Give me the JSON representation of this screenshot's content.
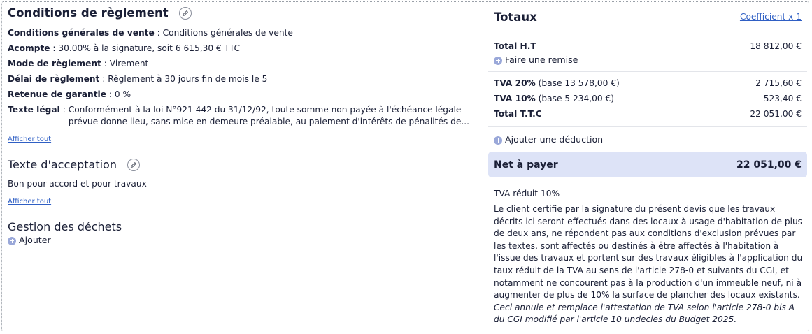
{
  "conditions": {
    "title": "Conditions de règlement",
    "rows": [
      {
        "label": "Conditions générales de vente",
        "value": "Conditions générales de vente"
      },
      {
        "label": "Acompte",
        "value": "30.00% à la signature, soit 6 615,30 € TTC"
      },
      {
        "label": "Mode de règlement",
        "value": "Virement"
      },
      {
        "label": "Délai de règlement",
        "value": "Règlement à 30 jours fin de mois le 5"
      },
      {
        "label": "Retenue de garantie",
        "value": "0 %"
      }
    ],
    "legal_label": "Texte légal",
    "legal_line1": "Conformément à la loi N°921 442 du 31/12/92, toute somme non payée à l'échéance légale",
    "legal_line2": "prévue donne lieu, sans mise en demeure préalable, au paiement d'intérêts de pénalités de...",
    "show_all": "Afficher tout"
  },
  "acceptance": {
    "title": "Texte d'acceptation",
    "text": "Bon pour accord et pour travaux",
    "show_all": "Afficher tout"
  },
  "waste": {
    "title": "Gestion des déchets",
    "add_label": "Ajouter"
  },
  "totals": {
    "title": "Totaux",
    "coefficient_link": "Coefficient x 1",
    "total_ht_label": "Total H.T",
    "total_ht_value": "18 812,00 €",
    "discount_label": "Faire une remise",
    "tva20_label": "TVA 20%",
    "tva20_base": "(base 13 578,00 €)",
    "tva20_value": "2 715,60 €",
    "tva10_label": "TVA 10%",
    "tva10_base": "(base 5 234,00 €)",
    "tva10_value": "523,40 €",
    "total_ttc_label": "Total T.T.C",
    "total_ttc_value": "22 051,00 €",
    "deduction_label": "Ajouter une déduction",
    "net_label": "Net à payer",
    "net_value": "22 051,00 €"
  },
  "tva_notice": {
    "title": "TVA réduit 10%",
    "body": "Le client certifie par la signature du présent devis que les travaux décrits ici seront effectués dans des locaux à usage d'habitation de plus de deux ans, ne répondent pas aux conditions d'exclusion prévues par les textes, sont affectés ou destinés à être affectés à l'habitation à l'issue des travaux et portent sur des travaux éligibles à l'application du taux réduit de la TVA au sens de l'article 278-0 et suivants du CGI, et notamment ne concourent pas à la production d'un immeuble neuf, ni à augmenter de plus de 10% la surface de plancher des locaux existants.",
    "italic": "Ceci annule et remplace l'attestation de TVA selon l'article 278-0 bis A du CGI modifié par l'article 10 undecies du Budget 2025."
  },
  "colors": {
    "accent": "#2f5fc4",
    "net_bg": "#dde3f7",
    "add_icon": "#9aa8d9"
  }
}
